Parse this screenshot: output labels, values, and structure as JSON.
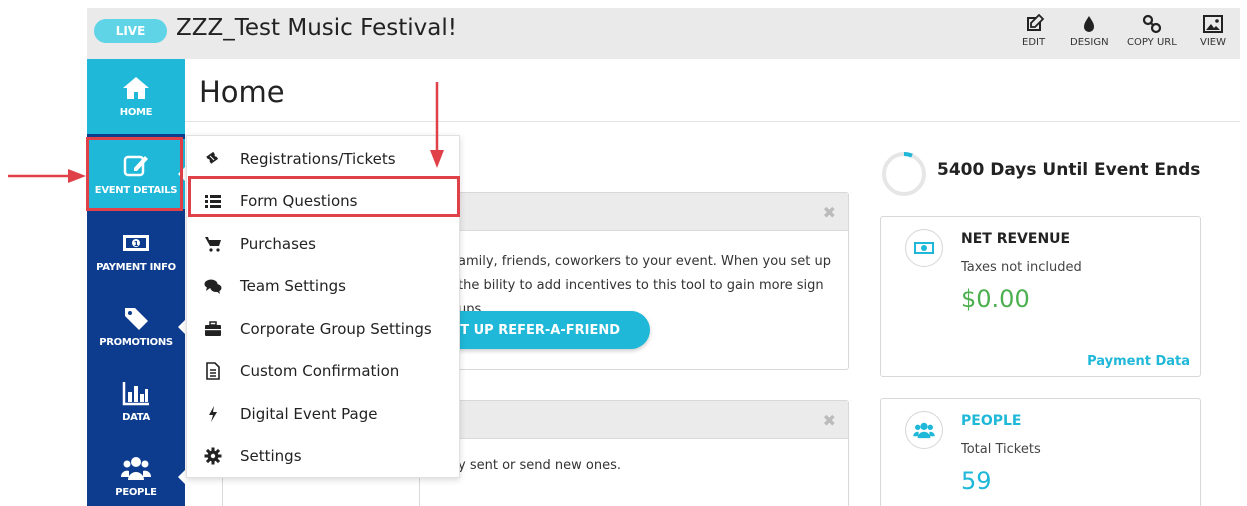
{
  "header": {
    "status": "LIVE",
    "event_title": "ZZZ_Test Music Festival!",
    "actions": [
      {
        "label": "EDIT",
        "icon": "edit-icon"
      },
      {
        "label": "DESIGN",
        "icon": "droplet-icon"
      },
      {
        "label": "COPY URL",
        "icon": "link-icon"
      },
      {
        "label": "VIEW",
        "icon": "image-icon"
      }
    ]
  },
  "sidebar": {
    "items": [
      {
        "label": "HOME",
        "icon": "home-icon"
      },
      {
        "label": "EVENT DETAILS",
        "icon": "edit-square-icon"
      },
      {
        "label": "PAYMENT INFO",
        "icon": "money-icon"
      },
      {
        "label": "PROMOTIONS",
        "icon": "tag-icon"
      },
      {
        "label": "DATA",
        "icon": "bar-chart-icon"
      },
      {
        "label": "PEOPLE",
        "icon": "users-icon"
      }
    ]
  },
  "main": {
    "title": "Home",
    "refer_text": "amily, friends, coworkers to your event. When you set up the bility to add incentives to this tool to gain more sign ups.",
    "refer_button": "SET UP REFER-A-FRIEND",
    "email_text": "y sent or send new ones."
  },
  "menu": {
    "items": [
      {
        "label": "Registrations/Tickets",
        "icon": "ticket-icon"
      },
      {
        "label": "Form Questions",
        "icon": "list-icon"
      },
      {
        "label": "Purchases",
        "icon": "cart-icon"
      },
      {
        "label": "Team Settings",
        "icon": "chat-icon"
      },
      {
        "label": "Corporate Group Settings",
        "icon": "briefcase-icon"
      },
      {
        "label": "Custom Confirmation",
        "icon": "document-icon"
      },
      {
        "label": "Digital Event Page",
        "icon": "bolt-icon"
      },
      {
        "label": "Settings",
        "icon": "gear-icon"
      }
    ]
  },
  "right": {
    "countdown": "5400 Days Until Event Ends",
    "revenue": {
      "label": "NET REVENUE",
      "sub": "Taxes not included",
      "value": "$0.00",
      "link": "Payment Data"
    },
    "people": {
      "label": "PEOPLE",
      "sub": "Total Tickets",
      "value": "59"
    }
  },
  "colors": {
    "accent": "#1fb8d8",
    "sidebar": "#0d3c8e",
    "highlight": "#e04048",
    "revenue_value": "#4caf50"
  }
}
